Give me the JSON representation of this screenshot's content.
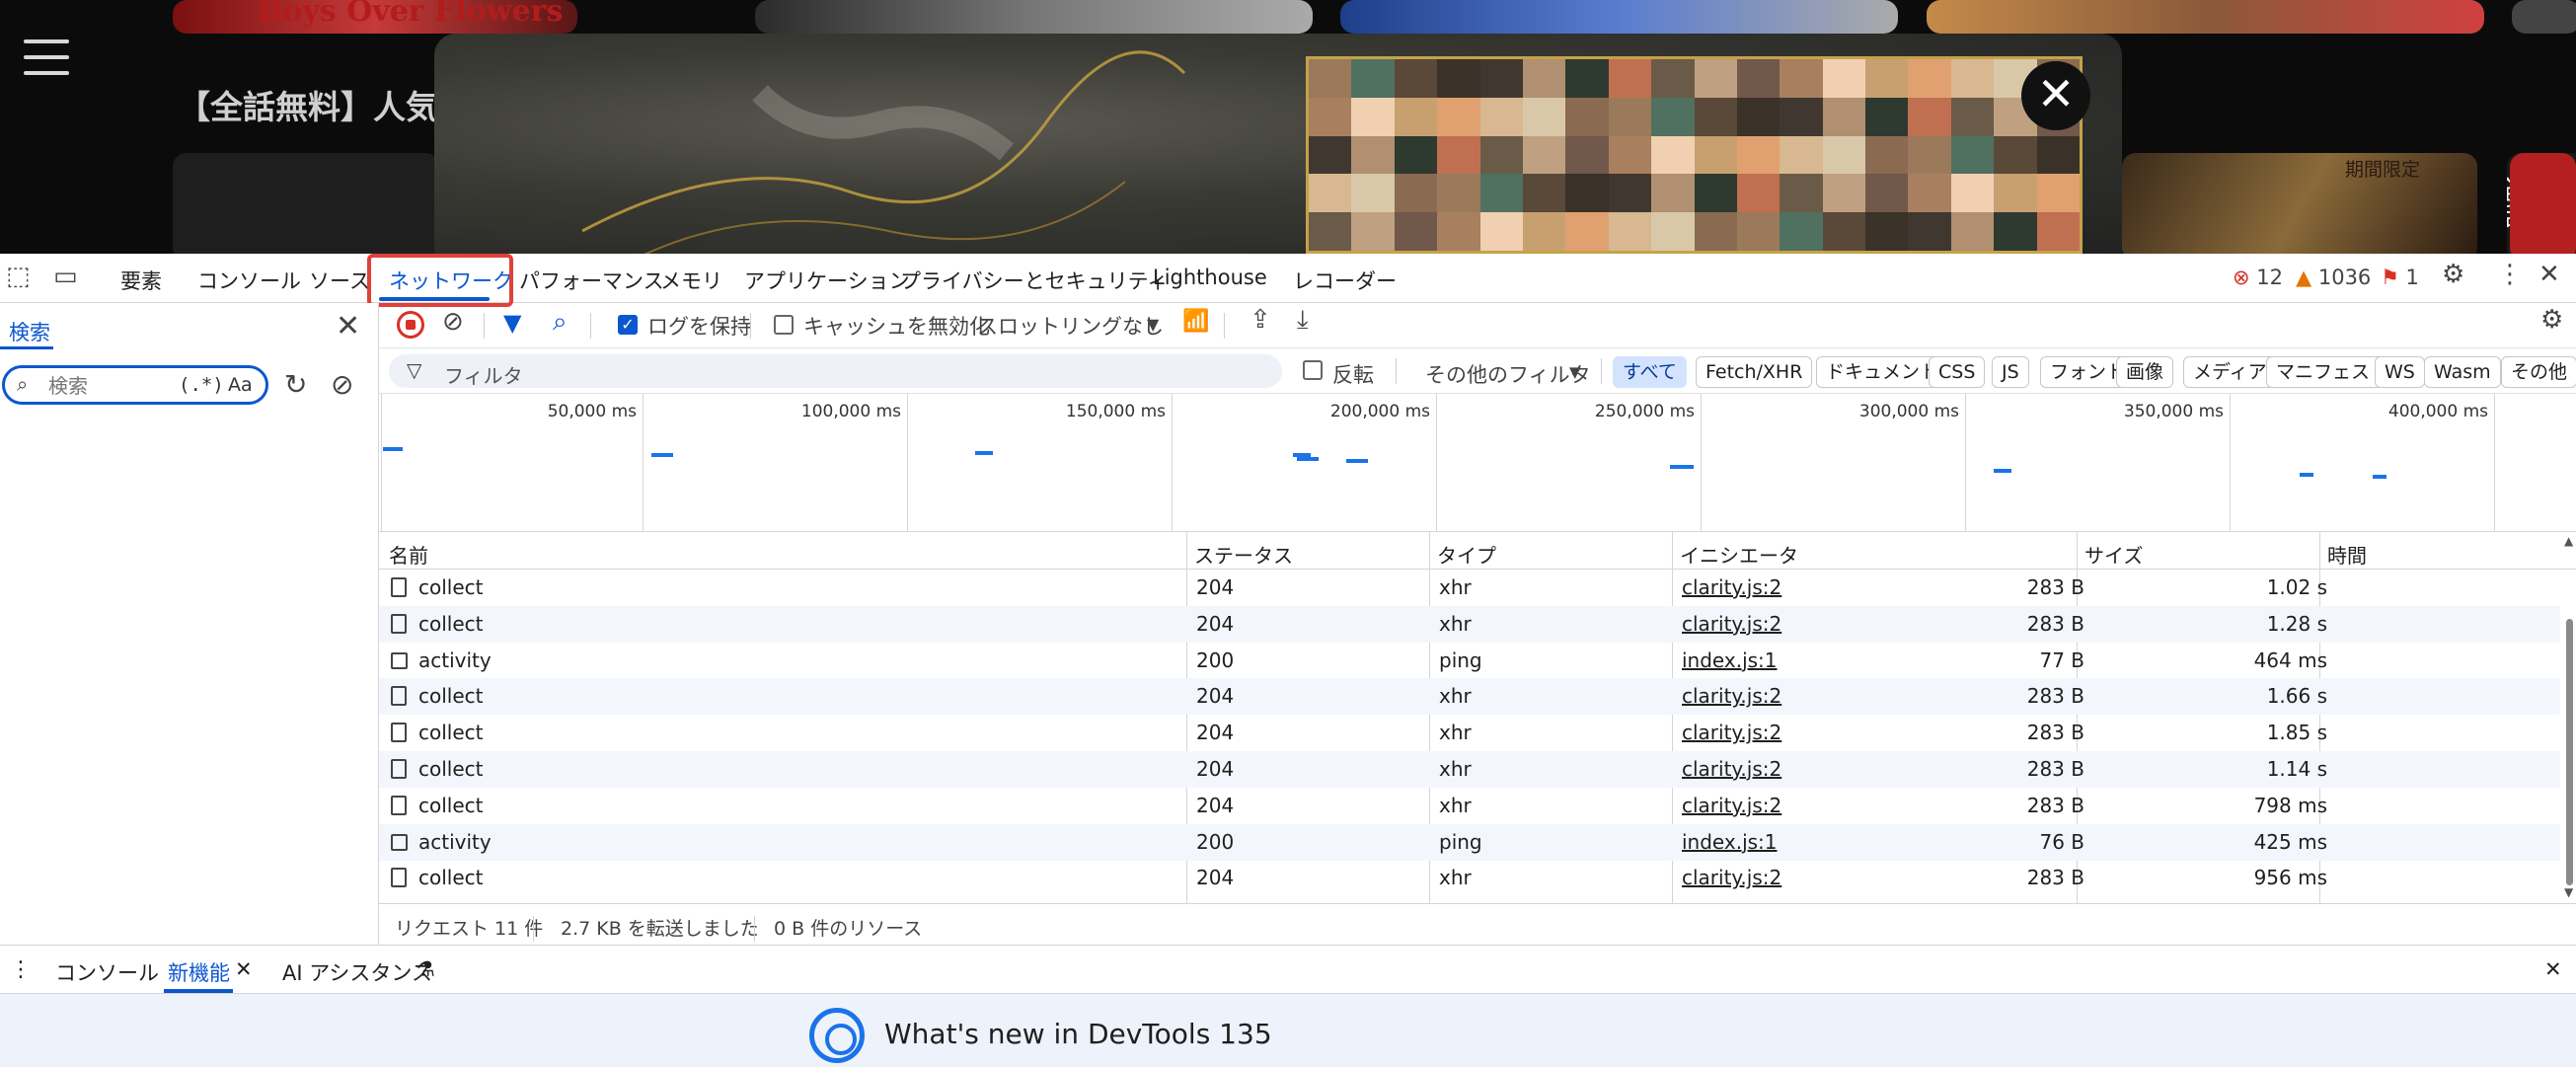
{
  "webpage": {
    "heading": "【全話無料】人気",
    "banner_text": "Boys Over Flowers",
    "side_tag": "期間限定",
    "side_title": "全話",
    "modal_close": "✕"
  },
  "devtools": {
    "main_tabs": [
      "要素",
      "コンソール",
      "ソース",
      "ネットワーク",
      "パフォーマンス",
      "メモリ",
      "アプリケーション",
      "プライバシーとセキュリティ",
      "Lighthouse",
      "レコーダー"
    ],
    "active_tab": "ネットワーク",
    "issues": {
      "errors": "12",
      "warnings": "1036",
      "info": "1"
    },
    "search_drawer": {
      "title": "検索",
      "placeholder": "検索",
      "regex_label": "(.*)",
      "case_label": "Aa"
    },
    "network": {
      "preserve_log_label": "ログを保持",
      "preserve_log_checked": true,
      "disable_cache_label": "キャッシュを無効化",
      "disable_cache_checked": false,
      "throttling": "スロットリングなし",
      "filter_placeholder": "フィルタ",
      "invert_label": "反転",
      "more_filters": "その他のフィルタ",
      "type_chips": [
        "すべて",
        "Fetch/XHR",
        "ドキュメント",
        "CSS",
        "JS",
        "フォント",
        "画像",
        "メディア",
        "マニフェスト",
        "WS",
        "Wasm",
        "その他"
      ],
      "active_chip": "すべて",
      "overview_ticks": [
        "50,000 ms",
        "100,000 ms",
        "150,000 ms",
        "200,000 ms",
        "250,000 ms",
        "300,000 ms",
        "350,000 ms",
        "400,000 ms"
      ],
      "columns": [
        "名前",
        "ステータス",
        "タイプ",
        "イニシエータ",
        "サイズ",
        "時間"
      ],
      "rows": [
        {
          "name": "collect",
          "status": "204",
          "type": "xhr",
          "initiator": "clarity.js:2",
          "size": "283 B",
          "time": "1.02 s",
          "icon": "doc"
        },
        {
          "name": "collect",
          "status": "204",
          "type": "xhr",
          "initiator": "clarity.js:2",
          "size": "283 B",
          "time": "1.28 s",
          "icon": "doc"
        },
        {
          "name": "activity",
          "status": "200",
          "type": "ping",
          "initiator": "index.js:1",
          "size": "77 B",
          "time": "464 ms",
          "icon": "blank"
        },
        {
          "name": "collect",
          "status": "204",
          "type": "xhr",
          "initiator": "clarity.js:2",
          "size": "283 B",
          "time": "1.66 s",
          "icon": "doc"
        },
        {
          "name": "collect",
          "status": "204",
          "type": "xhr",
          "initiator": "clarity.js:2",
          "size": "283 B",
          "time": "1.85 s",
          "icon": "doc"
        },
        {
          "name": "collect",
          "status": "204",
          "type": "xhr",
          "initiator": "clarity.js:2",
          "size": "283 B",
          "time": "1.14 s",
          "icon": "doc"
        },
        {
          "name": "collect",
          "status": "204",
          "type": "xhr",
          "initiator": "clarity.js:2",
          "size": "283 B",
          "time": "798 ms",
          "icon": "doc"
        },
        {
          "name": "activity",
          "status": "200",
          "type": "ping",
          "initiator": "index.js:1",
          "size": "76 B",
          "time": "425 ms",
          "icon": "blank"
        },
        {
          "name": "collect",
          "status": "204",
          "type": "xhr",
          "initiator": "clarity.js:2",
          "size": "283 B",
          "time": "956 ms",
          "icon": "doc"
        }
      ],
      "status_bar": {
        "requests": "リクエスト 11 件",
        "transferred": "2.7 KB を転送しました",
        "resources": "0 B 件のリソース"
      }
    },
    "drawer": {
      "tabs": [
        "コンソール",
        "新機能",
        "AI アシスタンス"
      ],
      "active_tab": "新機能",
      "whats_new_title": "What's new in DevTools 135"
    }
  },
  "colors": {
    "accent": "#0b57d0",
    "record_red": "#d93025",
    "highlight_red": "#e0413a",
    "timeline_blue": "#1a73e8"
  }
}
